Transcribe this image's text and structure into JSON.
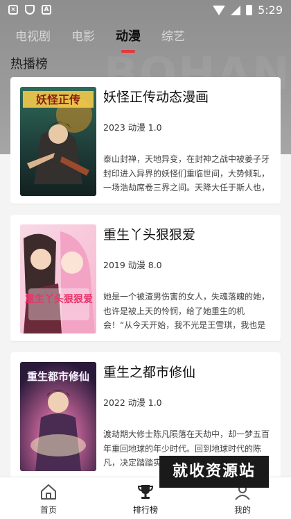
{
  "status_bar": {
    "time": "5:29"
  },
  "tabs": [
    {
      "label": "电视剧"
    },
    {
      "label": "电影"
    },
    {
      "label": "动漫"
    },
    {
      "label": "综艺"
    }
  ],
  "active_tab": "动漫",
  "section_title": "热播榜",
  "items": [
    {
      "title": "妖怪正传动态漫画",
      "meta": "2023 动漫 1.0",
      "description": "泰山封禅，天地异变，在封神之战中被姜子牙封印进入异界的妖怪们重临世间，大势倾轧，一场浩劫席卷三界之间。天降大任于斯人也，道宗弟子江",
      "cover_text": "妖怪正传"
    },
    {
      "title": "重生丫头狠狠爱",
      "meta": "2019 动漫 8.0",
      "description": "她是一个被渣男伤害的女人，失魂落魄的她，也许是被上天的怜悯，给了她重生的机会！“从今天开始，我不光是王雪琪，我也是冷月，我不光为自己而活",
      "cover_text": "重生丫头狠狠爱"
    },
    {
      "title": "重生之都市修仙",
      "meta": "2022 动漫 1.0",
      "description": "渡劫期大修士陈凡陨落在天劫中，却一梦五百年重回地球的年少时代。回到地球时代的陈凡，决定踏踏实实重新学习，扎实根基",
      "cover_text": "重生都市修仙"
    }
  ],
  "bottom_nav": [
    {
      "label": "首页"
    },
    {
      "label": "排行榜"
    },
    {
      "label": "我的"
    }
  ],
  "watermark_badge": "就收资源站",
  "colors": {
    "accent": "#e4393c",
    "header_bg": "#999999"
  }
}
